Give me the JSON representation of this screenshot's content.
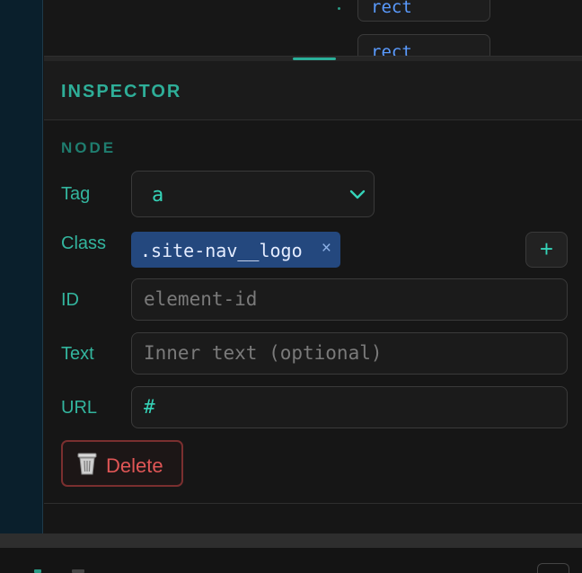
{
  "tree": {
    "nodes": [
      {
        "label": "rect"
      },
      {
        "label": "rect"
      }
    ]
  },
  "inspector": {
    "title": "INSPECTOR",
    "section_title": "NODE",
    "tag": {
      "label": "Tag",
      "value": "a"
    },
    "class": {
      "label": "Class",
      "chips": [
        {
          "label": ".site-nav__logo",
          "remove": "×"
        }
      ],
      "add_label": "+"
    },
    "id": {
      "label": "ID",
      "value": "",
      "placeholder": "element-id"
    },
    "text": {
      "label": "Text",
      "value": "",
      "placeholder": "Inner text (optional)"
    },
    "url": {
      "label": "URL",
      "value": "#"
    },
    "delete_label": "Delete"
  },
  "colors": {
    "accent": "#2eae98",
    "chip": "#24487e",
    "danger": "#e05656",
    "link_blue": "#5a9bff"
  },
  "icons": {
    "select": "chevron-down-icon",
    "delete": "trash-icon",
    "chip_remove": "close-icon",
    "add": "plus-icon"
  }
}
